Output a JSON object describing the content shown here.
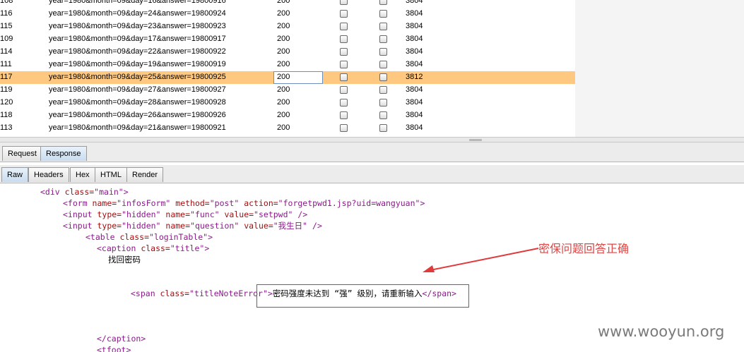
{
  "results": {
    "rows": [
      {
        "num": "108",
        "payload": "year=1980&month=09&day=16&answer=19800916",
        "status": "200",
        "length": "3804",
        "selected": false
      },
      {
        "num": "116",
        "payload": "year=1980&month=09&day=24&answer=19800924",
        "status": "200",
        "length": "3804",
        "selected": false
      },
      {
        "num": "115",
        "payload": "year=1980&month=09&day=23&answer=19800923",
        "status": "200",
        "length": "3804",
        "selected": false
      },
      {
        "num": "109",
        "payload": "year=1980&month=09&day=17&answer=19800917",
        "status": "200",
        "length": "3804",
        "selected": false
      },
      {
        "num": "114",
        "payload": "year=1980&month=09&day=22&answer=19800922",
        "status": "200",
        "length": "3804",
        "selected": false
      },
      {
        "num": "111",
        "payload": "year=1980&month=09&day=19&answer=19800919",
        "status": "200",
        "length": "3804",
        "selected": false
      },
      {
        "num": "117",
        "payload": "year=1980&month=09&day=25&answer=19800925",
        "status": "200",
        "length": "3812",
        "selected": true
      },
      {
        "num": "119",
        "payload": "year=1980&month=09&day=27&answer=19800927",
        "status": "200",
        "length": "3804",
        "selected": false
      },
      {
        "num": "120",
        "payload": "year=1980&month=09&day=28&answer=19800928",
        "status": "200",
        "length": "3804",
        "selected": false
      },
      {
        "num": "118",
        "payload": "year=1980&month=09&day=26&answer=19800926",
        "status": "200",
        "length": "3804",
        "selected": false
      },
      {
        "num": "113",
        "payload": "year=1980&month=09&day=21&answer=19800921",
        "status": "200",
        "length": "3804",
        "selected": false
      }
    ]
  },
  "message_tabs": {
    "request": "Request",
    "response": "Response",
    "active": "Response"
  },
  "view_tabs": {
    "raw": "Raw",
    "headers": "Headers",
    "hex": "Hex",
    "html": "HTML",
    "render": "Render",
    "active": "Raw"
  },
  "code": {
    "l1_tag": "<div",
    "l1_attr": " class=",
    "l1_val": "\"main\"",
    "l1_end": ">",
    "l2_tag": "<form",
    "l2_attr1": " name=",
    "l2_val1": "\"infosForm\"",
    "l2_attr2": " method=",
    "l2_val2": "\"post\"",
    "l2_attr3": " action=",
    "l2_val3": "\"forgetpwd1.jsp?uid=wangyuan\"",
    "l2_end": ">",
    "l3_tag": "<input",
    "l3_attr1": " type=",
    "l3_val1": "\"hidden\"",
    "l3_attr2": " name=",
    "l3_val2": "\"func\"",
    "l3_attr3": " value=",
    "l3_val3": "\"setpwd\"",
    "l3_end": " />",
    "l4_tag": "<input",
    "l4_attr1": " type=",
    "l4_val1": "\"hidden\"",
    "l4_attr2": " name=",
    "l4_val2": "\"question\"",
    "l4_attr3": " value=",
    "l4_val3": "\"我生日\"",
    "l4_end": " />",
    "l5_tag": "<table",
    "l5_attr": " class=",
    "l5_val": "\"loginTable\"",
    "l5_end": ">",
    "l6_tag": "<caption",
    "l6_attr": " class=",
    "l6_val": "\"title\"",
    "l6_end": ">",
    "l7_text": "找回密码",
    "l8_tag": "<span",
    "l8_attr": " class=",
    "l8_val": "\"titleNoteError\"",
    "l8_end": ">",
    "l8_text": "密码强度未达到 “强” 级别，请重新输入",
    "l8_close": "</span>",
    "l9_tag": "</caption>",
    "l10_tag": "<tfoot>"
  },
  "annotation": {
    "text": "密保问题回答正确",
    "color": "#e04545"
  },
  "watermark": "www.wooyun.org",
  "colors": {
    "selected_row": "#ffc880",
    "tag": "#8b1a8b",
    "attribute": "#a01010",
    "highlight_box": "#e03030"
  }
}
